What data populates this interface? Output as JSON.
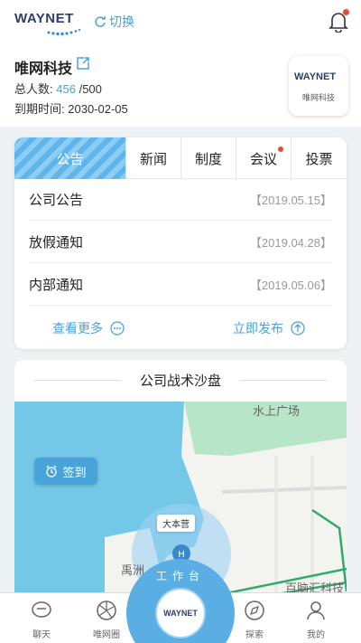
{
  "header": {
    "logo_text": "WAYNET",
    "switch_label": "切换",
    "company_name": "唯网科技",
    "members_label": "总人数:",
    "members_count": "456",
    "members_total": "/500",
    "expiry_label": "到期时间:",
    "expiry_date": "2030-02-05",
    "badge_logo": "WAYNET",
    "badge_name": "唯网科技"
  },
  "notice": {
    "tabs": [
      {
        "label": "公告",
        "active": true
      },
      {
        "label": "新闻"
      },
      {
        "label": "制度"
      },
      {
        "label": "会议",
        "has_dot": true
      },
      {
        "label": "投票"
      }
    ],
    "items": [
      {
        "title": "公司公告",
        "date": "【2019.05.15】"
      },
      {
        "title": "放假通知",
        "date": "【2019.04.28】"
      },
      {
        "title": "内部通知",
        "date": "【2019.05.06】"
      }
    ],
    "more_label": "查看更多",
    "publish_label": "立即发布"
  },
  "map": {
    "title": "公司战术沙盘",
    "checkin_label": "签到",
    "labels": {
      "plaza": "水上广场",
      "camp": "大本营",
      "island": "禹洲",
      "tech": "百脑汇科技"
    }
  },
  "bottom_nav": {
    "items": [
      {
        "label": "聊天"
      },
      {
        "label": "唯网圈"
      },
      {
        "label": "探索"
      },
      {
        "label": "我的"
      }
    ],
    "work_label": "工作台",
    "center_logo": "WAYNET"
  },
  "colors": {
    "accent": "#4aa3d8",
    "water": "#73c8e8",
    "park": "#b7e6c6",
    "road": "#2faa6b",
    "alert_dot": "#e24a3b"
  }
}
